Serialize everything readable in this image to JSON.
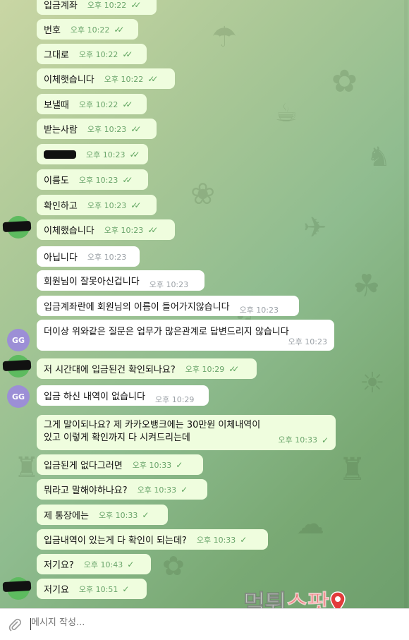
{
  "chat": {
    "messages": [
      {
        "text": "입금계좌",
        "time": "오후 10:22",
        "side": "out"
      },
      {
        "text": "번호",
        "time": "오후 10:22",
        "side": "out"
      },
      {
        "text": "그대로",
        "time": "오후 10:22",
        "side": "out"
      },
      {
        "text": "이체햇습니다",
        "time": "오후 10:22",
        "side": "out"
      },
      {
        "text": "보낼때",
        "time": "오후 10:22",
        "side": "out"
      },
      {
        "text": "받는사람",
        "time": "오후 10:23",
        "side": "out"
      },
      {
        "text": "",
        "time": "오후 10:23",
        "side": "out",
        "redacted": true
      },
      {
        "text": "이름도",
        "time": "오후 10:23",
        "side": "out"
      },
      {
        "text": "확인하고",
        "time": "오후 10:23",
        "side": "out"
      },
      {
        "text": "이체했습니다",
        "time": "오후 10:23",
        "side": "out"
      },
      {
        "text": "아닙니다",
        "time": "오후 10:23",
        "side": "in"
      },
      {
        "text": "회원님이 잘못아신겁니다",
        "time": "오후 10:23",
        "side": "in"
      },
      {
        "text": "입금계좌란에 회원님의 이름이 들어가지않습니다",
        "time": "오후 10:23",
        "side": "in"
      },
      {
        "text": "더이상 위와같은 질문은 업무가 많은관계로 답변드리지 않습니다",
        "time": "오후 10:23",
        "side": "in"
      },
      {
        "text": "저 시간대에 입금된건 확인되나요?",
        "time": "오후 10:29",
        "side": "out"
      },
      {
        "text": "입금 하신 내역이 없습니다",
        "time": "오후 10:29",
        "side": "in"
      },
      {
        "text": "그게 말이되나요? 제 카카오뱅크에는 30만원 이체내역이 있고 이렇게 확인까지 다 시켜드리는데",
        "time": "오후 10:33",
        "side": "out"
      },
      {
        "text": "입금된게 없다그러면",
        "time": "오후 10:33",
        "side": "out"
      },
      {
        "text": "뭐라고 말해야하나요?",
        "time": "오후 10:33",
        "side": "out"
      },
      {
        "text": "제 통장에는",
        "time": "오후 10:33",
        "side": "out"
      },
      {
        "text": "입금내역이 있는게 다 확인이 되는데?",
        "time": "오후 10:33",
        "side": "out"
      },
      {
        "text": "저기요?",
        "time": "오후 10:43",
        "side": "out"
      },
      {
        "text": "저기요",
        "time": "오후 10:51",
        "side": "out"
      }
    ],
    "avatar_initials": "GG",
    "ticks_double": "✓✓",
    "ticks_single": "✓"
  },
  "composer": {
    "placeholder": "메시지 작성...",
    "attach_icon": "paperclip-icon"
  },
  "watermark": {
    "part1": "먹튀",
    "part2": "스팟"
  },
  "colors": {
    "outgoing_bubble": "#effdde",
    "incoming_bubble": "#ffffff",
    "check": "#5fa55f",
    "avatar_gg": "#9c8fd6",
    "avatar_self": "#5dbb5f"
  }
}
